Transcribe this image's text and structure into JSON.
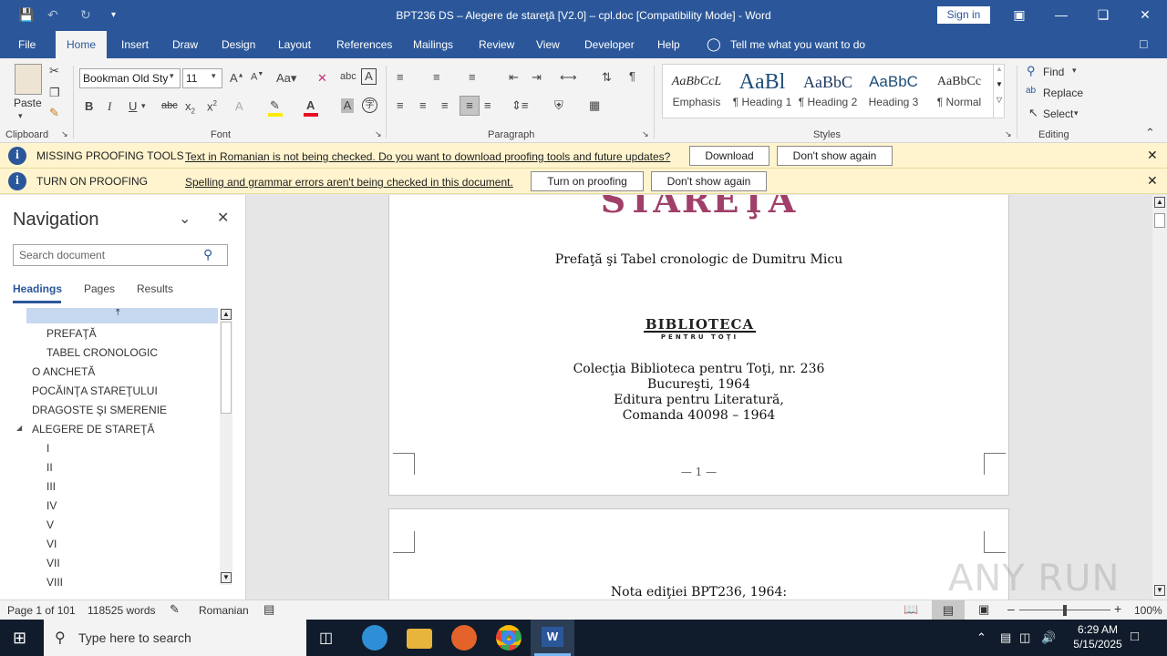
{
  "window": {
    "title": "BPT236 DS – Alegere de stareţă [V2.0] – cpl.doc [Compatibility Mode]  -  Word",
    "sign_in": "Sign in"
  },
  "menu": {
    "file": "File",
    "home": "Home",
    "insert": "Insert",
    "draw": "Draw",
    "design": "Design",
    "layout": "Layout",
    "references": "References",
    "mailings": "Mailings",
    "review": "Review",
    "view": "View",
    "developer": "Developer",
    "help": "Help",
    "tell_me": "Tell me what you want to do"
  },
  "ribbon": {
    "paste": "Paste",
    "font_name": "Bookman Old Sty",
    "font_size": "11",
    "groups": {
      "clipboard": "Clipboard",
      "font": "Font",
      "paragraph": "Paragraph",
      "styles": "Styles",
      "editing": "Editing"
    },
    "styles": [
      {
        "preview": "AaBbCcL",
        "name": "Emphasis"
      },
      {
        "preview": "AaBl",
        "name": "¶ Heading 1"
      },
      {
        "preview": "AaBbC",
        "name": "¶ Heading 2"
      },
      {
        "preview": "AaBbC",
        "name": "Heading 3"
      },
      {
        "preview": "AaBbCc",
        "name": "¶ Normal"
      }
    ],
    "editing": {
      "find": "Find",
      "replace": "Replace",
      "select": "Select"
    }
  },
  "notifications": [
    {
      "title": "MISSING PROOFING TOOLS",
      "message": "Text in Romanian is not being checked. Do you want to download proofing tools and future updates?",
      "primary": "Download",
      "secondary": "Don't show again"
    },
    {
      "title": "TURN ON PROOFING",
      "message": "Spelling and grammar errors aren't being checked in this document.",
      "primary": "Turn on proofing",
      "secondary": "Don't show again"
    }
  ],
  "navigation": {
    "title": "Navigation",
    "search_placeholder": "Search document",
    "tabs": [
      "Headings",
      "Pages",
      "Results"
    ],
    "items": [
      "PREFAŢĂ",
      "TABEL CRONOLOGIC",
      "O ANCHETĂ",
      "POCĂINŢA STAREŢULUI",
      "DRAGOSTE ŞI SMERENIE",
      "ALEGERE DE STAREŢĂ",
      "I",
      "II",
      "III",
      "IV",
      "V",
      "VI",
      "VII",
      "VIII"
    ]
  },
  "document": {
    "title_fragment": "STAREŢA",
    "preface": "Prefaţă şi Tabel cronologic de Dumitru Micu",
    "logo_top": "BIBLIOTECA",
    "logo_bottom": "PENTRU TOŢI",
    "lines": [
      "Colecţia Biblioteca pentru Toţi, nr. 236",
      "Bucureşti, 1964",
      "Editura pentru Literatură,",
      "Comanda 40098 – 1964"
    ],
    "page_number": "— 1 —",
    "page2_text": "Nota ediţiei BPT236, 1964:"
  },
  "status": {
    "page": "Page 1 of 101",
    "words": "118525 words",
    "language": "Romanian",
    "zoom": "100%"
  },
  "taskbar": {
    "search_placeholder": "Type here to search",
    "time": "6:29 AM",
    "date": "5/15/2025"
  },
  "watermark": "ANY RUN"
}
